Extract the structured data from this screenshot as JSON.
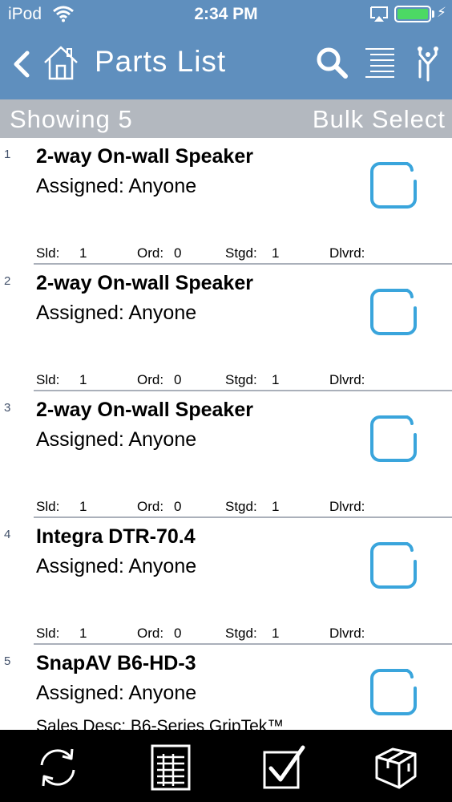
{
  "status_bar": {
    "carrier": "iPod",
    "time": "2:34 PM",
    "battery_color": "#4cd964"
  },
  "nav": {
    "title": "Parts List",
    "background_color": "#5f8fbe",
    "icons": [
      "back-chevron-icon",
      "home-icon",
      "search-icon",
      "list-icon",
      "filter-icon"
    ]
  },
  "subheader": {
    "showing": "Showing 5",
    "bulk_select": "Bulk Select"
  },
  "labels": {
    "sold": "Sld:",
    "ordered": "Ord:",
    "staged": "Stgd:",
    "delivered": "Dlvrd:"
  },
  "items": [
    {
      "index": "1",
      "name": "2-way On-wall Speaker",
      "assigned": "Assigned: Anyone",
      "sold": "1",
      "ordered": "0",
      "staged": "1",
      "delivered": ""
    },
    {
      "index": "2",
      "name": "2-way On-wall Speaker",
      "assigned": "Assigned: Anyone",
      "sold": "1",
      "ordered": "0",
      "staged": "1",
      "delivered": ""
    },
    {
      "index": "3",
      "name": "2-way On-wall Speaker",
      "assigned": "Assigned: Anyone",
      "sold": "1",
      "ordered": "0",
      "staged": "1",
      "delivered": ""
    },
    {
      "index": "4",
      "name": "Integra DTR-70.4",
      "assigned": "Assigned: Anyone",
      "sold": "1",
      "ordered": "0",
      "staged": "1",
      "delivered": ""
    },
    {
      "index": "5",
      "name": "SnapAV B6-HD-3",
      "assigned": "Assigned: Anyone",
      "sales_desc": "Sales Desc: B6-Series GripTek™"
    }
  ],
  "tab_bar": {
    "icons": [
      "sync-icon",
      "report-icon",
      "checklist-icon",
      "package-icon"
    ]
  },
  "colors": {
    "checkbox": "#3aa5dc",
    "subheader": "#b3b8bf",
    "tabbar": "#000000"
  }
}
